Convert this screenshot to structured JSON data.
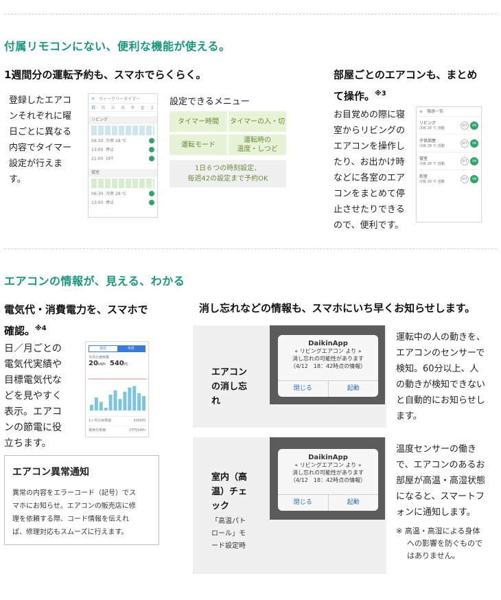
{
  "section1": {
    "heading": "付属リモコンにない、便利な機能が使える。",
    "weekly": {
      "title": "1週間分の運転予約も、スマホでらくらく。",
      "body": [
        "登録したエアコ",
        "ンそれぞれに曜",
        "日ごとに異なる",
        "内容でタイマー",
        "設定が行えま",
        "す。"
      ],
      "phone": {
        "title": "ウィークリータイマー",
        "days": [
          "日",
          "月",
          "火",
          "水",
          "木",
          "金",
          "土"
        ],
        "rooms": [
          {
            "name": "リビング",
            "rows": [
              {
                "time": "06:30",
                "mode": "冷房 28 ℃"
              },
              {
                "time": "13:00",
                "mode": "停止"
              },
              {
                "time": "21:00",
                "mode": "OFF"
              }
            ]
          },
          {
            "name": "寝室",
            "rows": [
              {
                "time": "06:30",
                "mode": "冷房 28 ℃"
              },
              {
                "time": "13:00",
                "mode": "停止"
              }
            ]
          }
        ]
      },
      "menu_title": "設定できるメニュー",
      "menu_items": [
        "タイマー時間",
        "タイマーの入・切",
        "運転モード",
        "運転時の\n温度・しつど"
      ],
      "menu_note": "1日６つの時刻設定、\n毎週42の設定まで予約OK"
    },
    "rooms": {
      "title_line1": "部屋ごとのエアコンも、まとめ",
      "title_line2": "て操作。",
      "title_note": "※3",
      "body": [
        "お目覚めの際に寝",
        "室からリビングの",
        "エアコンを操作し",
        "たり、お出かけ時",
        "などに各室のエア",
        "コンをまとめて停",
        "止させたりできる",
        "ので、便利です。"
      ],
      "phone": {
        "title": "機器一覧",
        "items": [
          {
            "name": "リビング",
            "state": "冷房 28 ℃ 自動",
            "off": "OFF",
            "on": "ON"
          },
          {
            "name": "子供部屋",
            "state": "冷房 28 ℃ 自動",
            "off": "OFF",
            "on": "ON"
          },
          {
            "name": "寝室",
            "state": "冷房 28 ℃ 自動",
            "off": "OFF",
            "on": "ON"
          },
          {
            "name": "和室",
            "state": "冷房 28 ℃ 自動",
            "off": "OFF",
            "on": "ON"
          }
        ]
      }
    }
  },
  "section2": {
    "heading": "エアコンの情報が、見える、わかる",
    "power": {
      "title_line1": "電気代・消費電力を、スマホで",
      "title_line2": "確認。",
      "title_note": "※4",
      "body": [
        "日／月ごとの",
        "電気代実績や",
        "目標電気代な",
        "どを見やすく",
        "表示。エアコ",
        "ンの節電に役",
        "立ちます。"
      ],
      "phone": {
        "tabs": [
          "前日",
          "今月"
        ],
        "label": "今月の使用量",
        "kwh": "20",
        "kwh_unit": "kWh",
        "yen": "540",
        "yen_unit": "円",
        "bar_values": [
          0.2,
          0.45,
          0.3,
          0.1,
          0.55,
          0.7,
          0.4,
          0.65,
          0.8,
          0.85,
          0.6,
          0.5
        ],
        "row1_label": "1ヶ月の目標値",
        "row1_value": "3000円",
        "row2_label": "電気代単価",
        "row2_value": "27円/kWh"
      },
      "alert_box": {
        "title": "エアコン異常通知",
        "body": [
          "異常の内容をエラーコード（記号）でス",
          "マホにお知らせ。エアコンの販売店に修",
          "理を依頼する際、コード情報を伝えれ",
          "ば、修理対応もスムーズに行えます。"
        ]
      }
    },
    "notify": {
      "title": "消し忘れなどの情報も、スマホにいち早くお知らせします。",
      "panel1": {
        "label": [
          "エアコン",
          "の消し忘",
          "れ"
        ],
        "dialog": {
          "app": "DaikinApp",
          "line1": "« リビングエアコン より »",
          "line2": "消し忘れの可能性があります",
          "line3": "（4/12　18：42時点の情報）",
          "btn_close": "閉じる",
          "btn_start": "起動"
        },
        "desc": [
          "運転中の人の動きを、",
          "エアコンのセンサーで",
          "検知。60分以上、人",
          "の動きが検知できない",
          "と自動的にお知らせし",
          "ます。"
        ]
      },
      "panel2": {
        "label": [
          "室内（高",
          "温）チェ",
          "ック"
        ],
        "sublabel": [
          "「高温パト",
          "ロール」モ",
          "ード設定時"
        ],
        "dialog": {
          "app": "DaikinApp",
          "line1": "« リビングエアコン より »",
          "line2": "消し忘れの可能性があります",
          "line3": "（4/12　18：42時点の情報）",
          "btn_close": "閉じる",
          "btn_start": "起動"
        },
        "desc": [
          "温度センサーの働き",
          "で、エアコンのあるお",
          "部屋が高温・高湿状態",
          "になると、スマートフ",
          "ォンに通知します。"
        ],
        "note": [
          "※ 高温・高湿による身体",
          "への影響を防ぐもので",
          "はありません。"
        ]
      }
    }
  },
  "colors": {
    "accent": "#17977d",
    "toggle_on": "#2ea66b",
    "menu_bg": "#e7f2d7",
    "panel_bg": "#f0f0f0",
    "link_blue": "#2f6fb5"
  }
}
